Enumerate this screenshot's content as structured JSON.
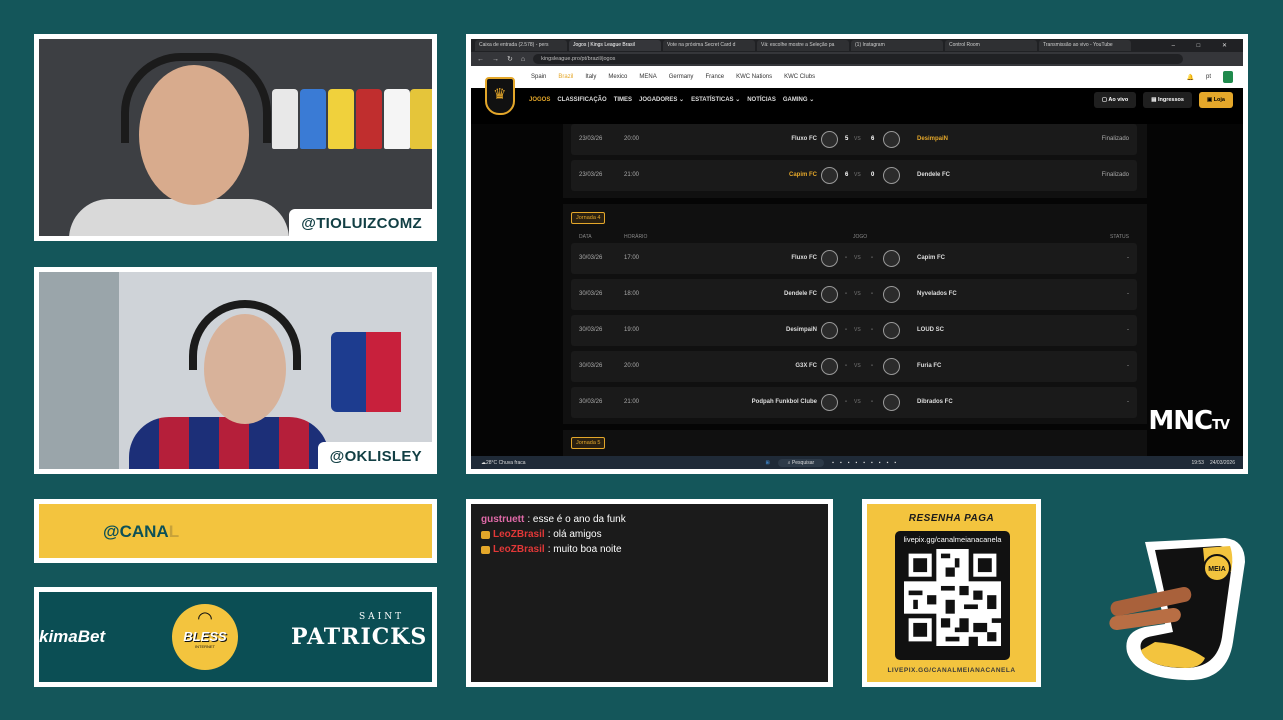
{
  "webcams": [
    {
      "handle": "@TIOLUIZCOMZ"
    },
    {
      "handle": "@OKLISLEY"
    }
  ],
  "browser": {
    "tabs": [
      {
        "label": "Caixa de entrada (2.578) - pers"
      },
      {
        "label": "Jogos | Kings League Brasil",
        "active": true
      },
      {
        "label": "Vote na próxima Secret Card d"
      },
      {
        "label": "Vá: escolhe mostre a Seleção pa"
      },
      {
        "label": "(1) Instagram"
      },
      {
        "label": "Control Room"
      },
      {
        "label": "Transmissão ao vivo - YouTube"
      }
    ],
    "url": "kingsleague.pro/pt/brazil/jogos",
    "window_controls": "–  □  ✕",
    "site_top_links": [
      {
        "label": "Spain"
      },
      {
        "label": "Brazil",
        "active": true
      },
      {
        "label": "Italy"
      },
      {
        "label": "Mexico"
      },
      {
        "label": "MENA"
      },
      {
        "label": "Germany"
      },
      {
        "label": "France"
      },
      {
        "label": "KWC Nations"
      },
      {
        "label": "KWC Clubs"
      }
    ],
    "lang": "pt",
    "site_nav": [
      {
        "label": "JOGOS",
        "active": true
      },
      {
        "label": "CLASSIFICAÇÃO"
      },
      {
        "label": "TIMES"
      },
      {
        "label": "JOGADORES ⌄"
      },
      {
        "label": "ESTATÍSTICAS ⌄"
      },
      {
        "label": "NOTÍCIAS"
      },
      {
        "label": "GAMING ⌄"
      }
    ],
    "nav_buttons": {
      "live": "Ao vivo",
      "tickets": "Ingressos",
      "shop": "Loja"
    },
    "finished_matches": [
      {
        "date": "23/03/26",
        "time": "20:00",
        "home": "Fluxo FC",
        "home_score": "5",
        "away_score": "6",
        "away": "DesimpaiN",
        "away_highlight": true,
        "status": "Finalizado"
      },
      {
        "date": "23/03/26",
        "time": "21:00",
        "home": "Capim FC",
        "home_highlight": true,
        "home_score": "6",
        "away_score": "0",
        "away": "Dendele FC",
        "status": "Finalizado"
      }
    ],
    "jornada4": {
      "label": "Jornada 4",
      "headers": {
        "date": "DATA",
        "time": "HORÁRIO",
        "game": "JOGO",
        "status": "STATUS"
      },
      "matches": [
        {
          "date": "30/03/26",
          "time": "17:00",
          "home": "Fluxo FC",
          "away": "Capim FC",
          "status": "-"
        },
        {
          "date": "30/03/26",
          "time": "18:00",
          "home": "Dendele FC",
          "away": "Nyvelados FC",
          "status": "-"
        },
        {
          "date": "30/03/26",
          "time": "19:00",
          "home": "DesimpaiN",
          "away": "LOUD SC",
          "status": "-"
        },
        {
          "date": "30/03/26",
          "time": "20:00",
          "home": "G3X FC",
          "away": "Furia FC",
          "status": "-"
        },
        {
          "date": "30/03/26",
          "time": "21:00",
          "home": "Podpah Funkbol Clube",
          "away": "Dibrados FC",
          "status": "-"
        }
      ]
    },
    "jornada5_label": "Jornada 5",
    "vs": "VS",
    "dash": "-",
    "taskbar": {
      "weather_temp": "28°C",
      "weather_desc": "Chuva fraca",
      "search": "Pesquisar",
      "time": "19:53",
      "date": "24/03/2026"
    },
    "watermark_main": "MNC",
    "watermark_sub": "TV"
  },
  "canal_bar": {
    "text_main": "@CANA",
    "text_fade": "L"
  },
  "sponsors": {
    "left": "kimaBet",
    "bless_main": "BLESS",
    "bless_sub": "INTERNET",
    "right_small": "SAINT",
    "right_main": "PATRICKS"
  },
  "chat": [
    {
      "user": "gustruett",
      "text": ": esse é o ano da funk",
      "badge": false,
      "color": "pink"
    },
    {
      "user": "LeoZBrasil",
      "text": ": olá amigos",
      "badge": true,
      "color": "red"
    },
    {
      "user": "LeoZBrasil",
      "text": ": muito boa noite",
      "badge": true,
      "color": "red"
    }
  ],
  "qr": {
    "title": "RESENHA PAGA",
    "url": "livepix.gg/canalmeianacanela",
    "footer": "LIVEPIX.GG/CANALMEIANACANELA"
  },
  "mascot": {
    "badge_text": "MEIA"
  },
  "colors": {
    "teal_bg": "#14565a",
    "gold": "#e4a72a",
    "yellow": "#f3c43e"
  }
}
